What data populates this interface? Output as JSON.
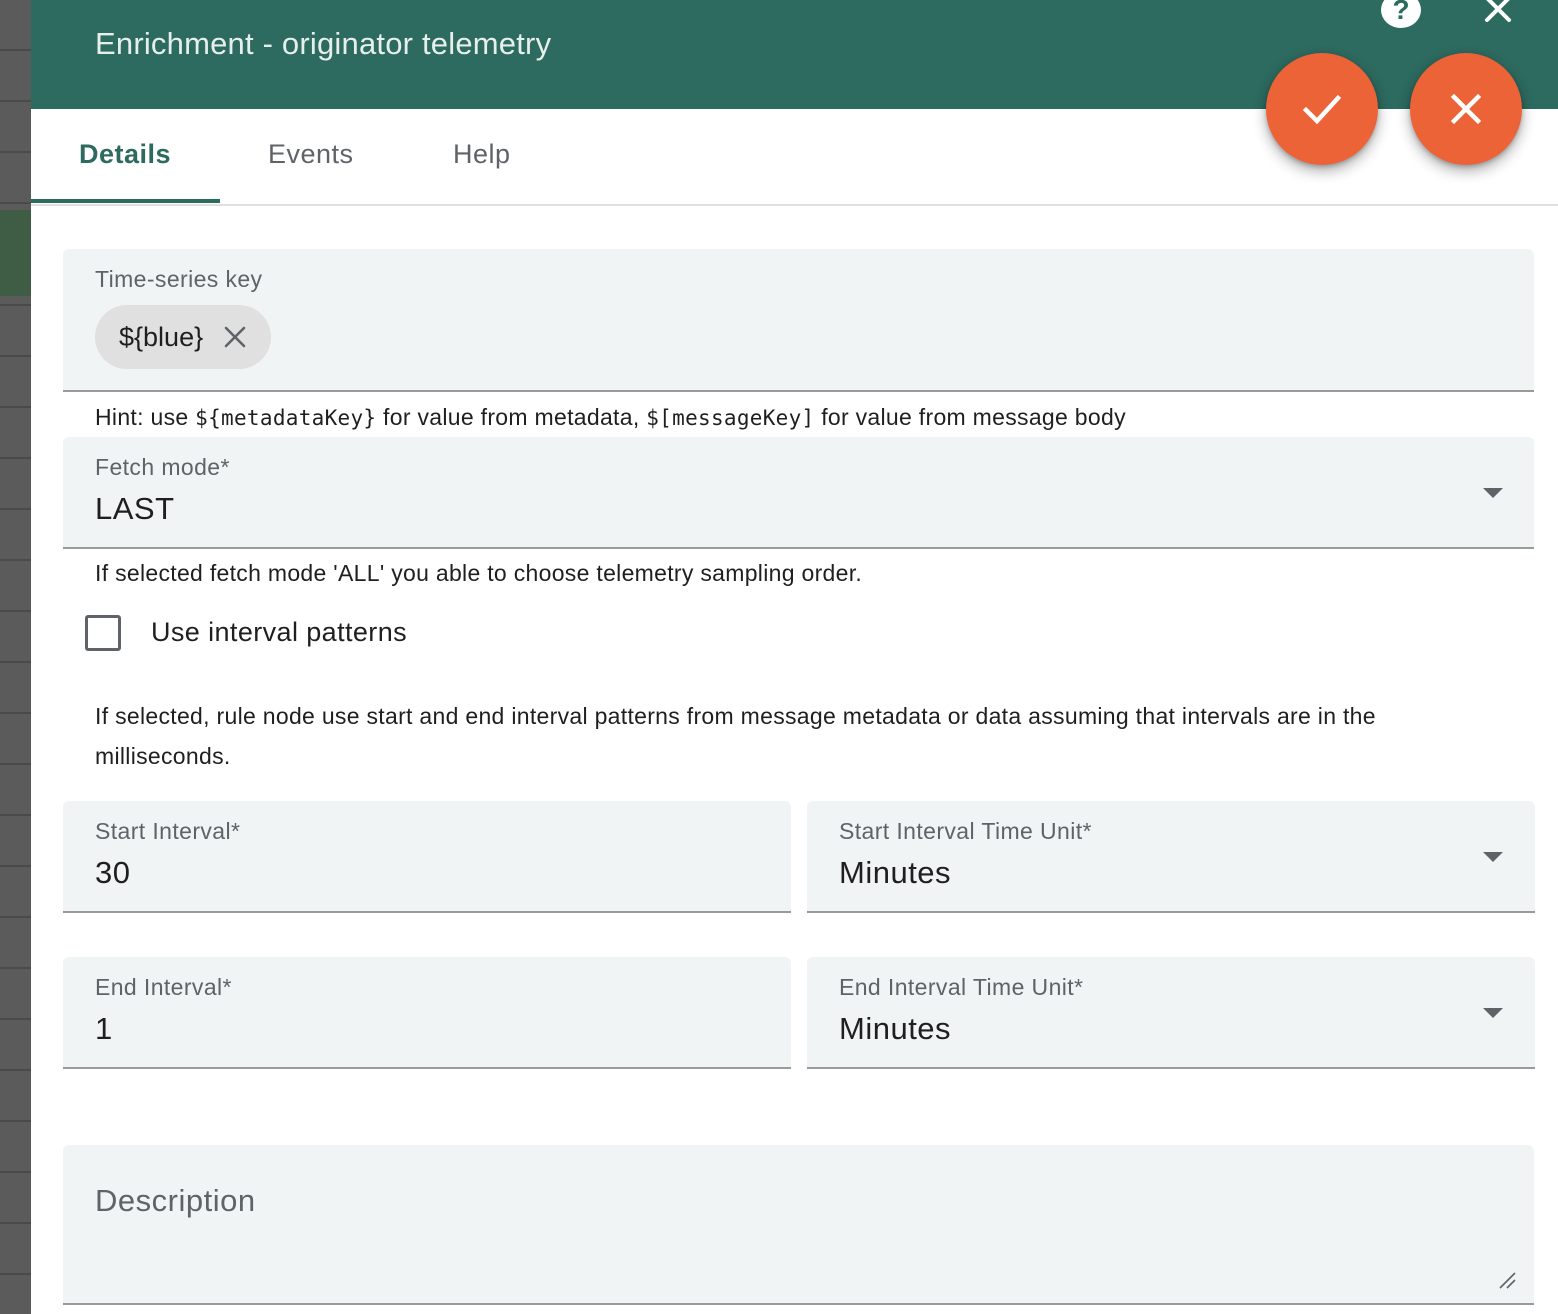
{
  "dialog": {
    "title": "Enrichment - originator telemetry",
    "help_icon": "?",
    "close_icon": "close-icon",
    "save_icon": "check-icon",
    "cancel_icon": "close-icon"
  },
  "tabs": [
    {
      "label": "Details",
      "active": true
    },
    {
      "label": "Events",
      "active": false
    },
    {
      "label": "Help",
      "active": false
    }
  ],
  "timeseries": {
    "label": "Time-series key",
    "chips": [
      "${blue}"
    ]
  },
  "hint": {
    "part1": "Hint: use ",
    "code1": "${metadataKey}",
    "part2": " for value from metadata, ",
    "code2": "$[messageKey]",
    "part3": " for value from message body"
  },
  "fetch_mode": {
    "label": "Fetch mode*",
    "value": "LAST",
    "hint": "If selected fetch mode 'ALL' you able to choose telemetry sampling order."
  },
  "interval_patterns": {
    "label": "Use interval patterns",
    "checked": false,
    "hint_line1": "If selected, rule node use start and end interval patterns from message metadata or data assuming that intervals are in the",
    "hint_line2": "milliseconds."
  },
  "start_interval": {
    "label": "Start Interval*",
    "value": "30"
  },
  "start_unit": {
    "label": "Start Interval Time Unit*",
    "value": "Minutes"
  },
  "end_interval": {
    "label": "End Interval*",
    "value": "1"
  },
  "end_unit": {
    "label": "End Interval Time Unit*",
    "value": "Minutes"
  },
  "description": {
    "placeholder": "Description"
  },
  "colors": {
    "header": "#2d6a5f",
    "accent": "#ec6338",
    "field_bg": "#f1f4f4"
  }
}
